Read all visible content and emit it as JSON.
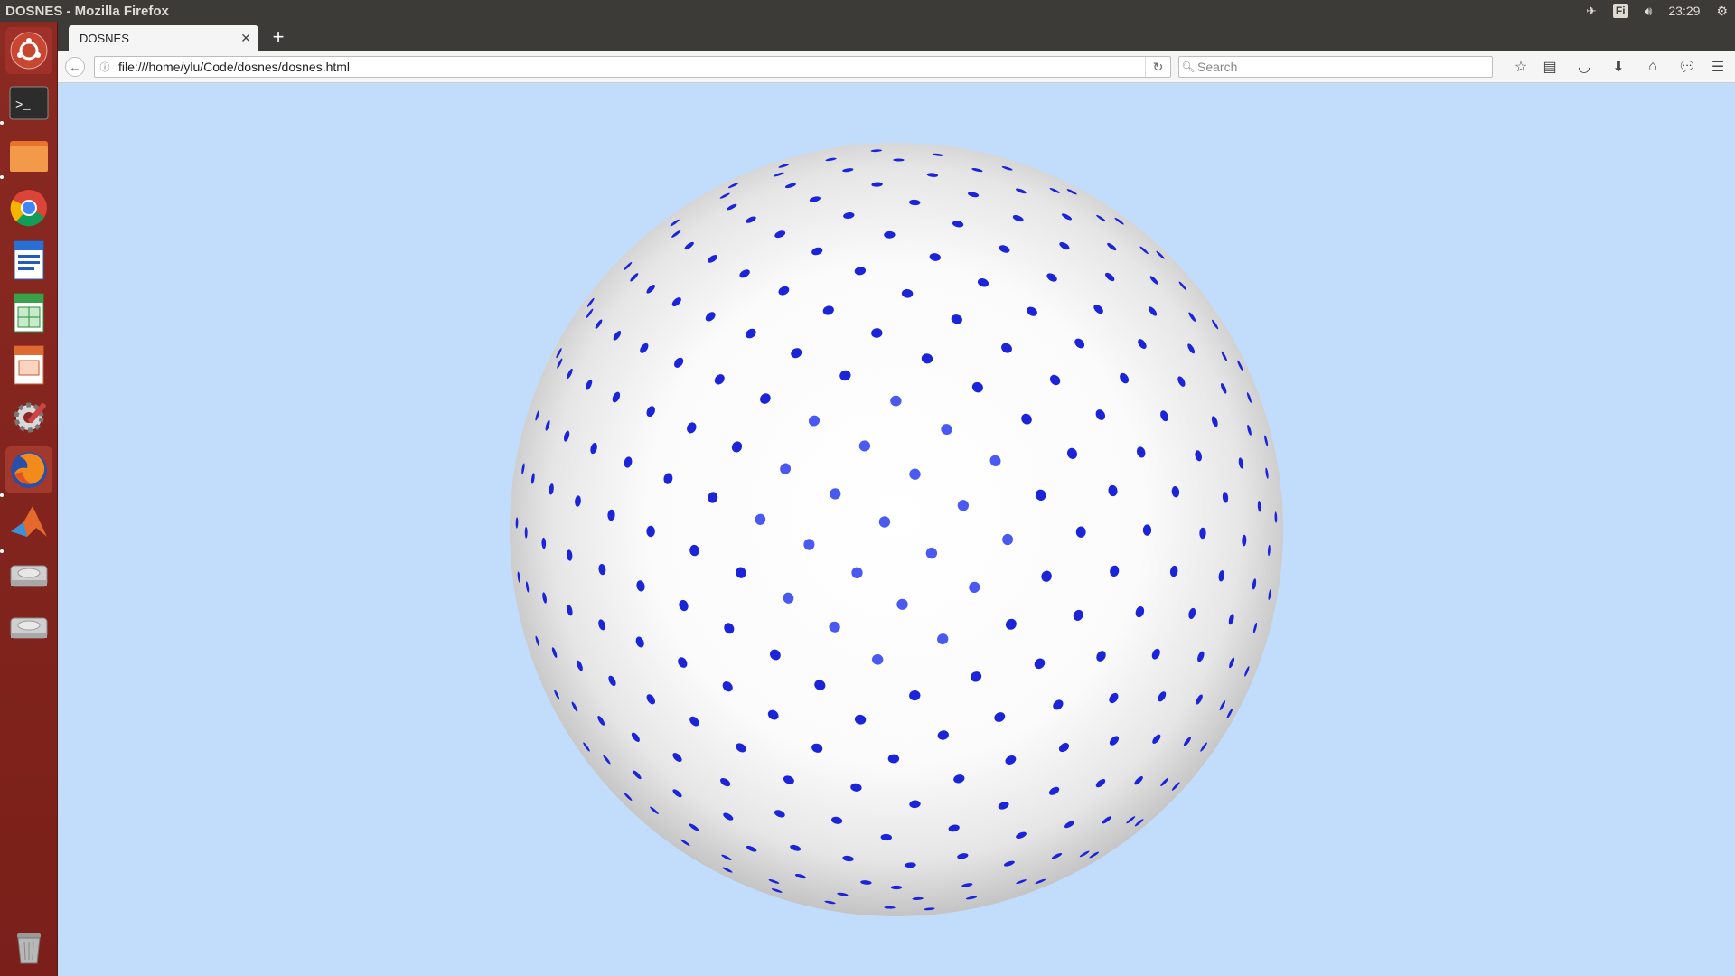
{
  "window": {
    "title": "DOSNES - Mozilla Firefox"
  },
  "panel": {
    "keyboard": "Fi",
    "clock": "23:29"
  },
  "launcher": {
    "items": [
      {
        "name": "ubuntu-dash"
      },
      {
        "name": "terminal"
      },
      {
        "name": "files"
      },
      {
        "name": "chrome"
      },
      {
        "name": "libreoffice-writer"
      },
      {
        "name": "libreoffice-calc"
      },
      {
        "name": "libreoffice-impress"
      },
      {
        "name": "system-settings"
      },
      {
        "name": "firefox"
      },
      {
        "name": "matlab"
      },
      {
        "name": "drive-1"
      },
      {
        "name": "drive-2"
      },
      {
        "name": "trash"
      }
    ]
  },
  "browser": {
    "tab_title": "DOSNES",
    "url": "file:///home/ylu/Code/dosnes/dosnes.html",
    "search_placeholder": "Search"
  },
  "scene": {
    "background": "#c2ddfc",
    "sphere_color": "#ffffff",
    "dot_color": "#1b24d8",
    "front_dot_color": "#4a5af0"
  }
}
